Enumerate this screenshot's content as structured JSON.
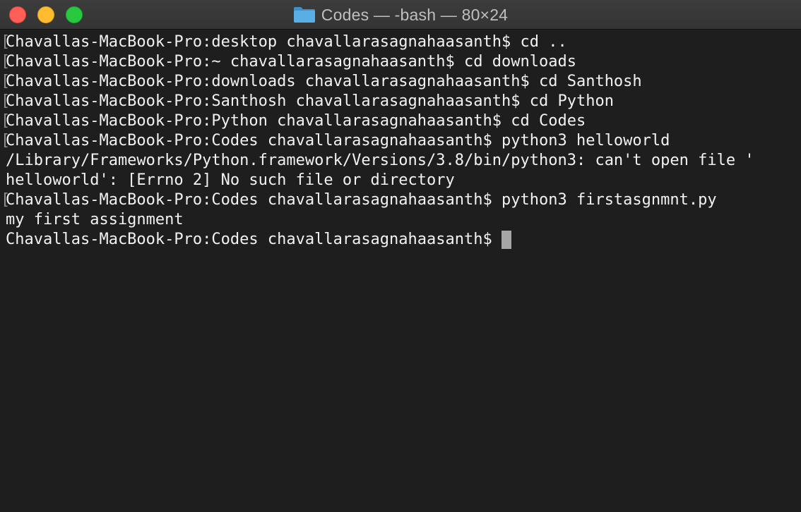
{
  "window": {
    "title": "Codes — -bash — 80×24"
  },
  "terminal": {
    "lines": [
      {
        "text": "Chavallas-MacBook-Pro:desktop chavallarasagnahaasanth$ cd ..",
        "marked": true
      },
      {
        "text": "Chavallas-MacBook-Pro:~ chavallarasagnahaasanth$ cd downloads",
        "marked": true
      },
      {
        "text": "Chavallas-MacBook-Pro:downloads chavallarasagnahaasanth$ cd Santhosh",
        "marked": true
      },
      {
        "text": "Chavallas-MacBook-Pro:Santhosh chavallarasagnahaasanth$ cd Python",
        "marked": true
      },
      {
        "text": "Chavallas-MacBook-Pro:Python chavallarasagnahaasanth$ cd Codes",
        "marked": true
      },
      {
        "text": "Chavallas-MacBook-Pro:Codes chavallarasagnahaasanth$ python3 helloworld",
        "marked": true
      },
      {
        "text": "/Library/Frameworks/Python.framework/Versions/3.8/bin/python3: can't open file '",
        "marked": false
      },
      {
        "text": "helloworld': [Errno 2] No such file or directory",
        "marked": false
      },
      {
        "text": "Chavallas-MacBook-Pro:Codes chavallarasagnahaasanth$ python3 firstasgnmnt.py",
        "marked": true
      },
      {
        "text": "my first assignment",
        "marked": false
      }
    ],
    "prompt": "Chavallas-MacBook-Pro:Codes chavallarasagnahaasanth$ "
  },
  "colors": {
    "background": "#1e1e1e",
    "text": "#f2f2f2",
    "cursor": "#a6a6a6",
    "close": "#ff5f57",
    "minimize": "#febc2e",
    "zoom": "#28c840",
    "folder": "#5aaee6"
  },
  "icons": {
    "title": "folder-icon"
  }
}
